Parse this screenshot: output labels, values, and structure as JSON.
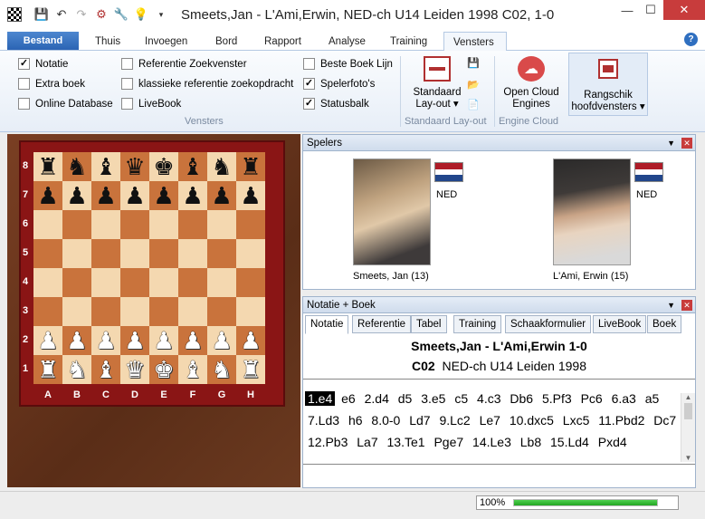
{
  "window": {
    "title": "Smeets,Jan - L'Ami,Erwin, NED-ch U14 Leiden 1998  C02, 1-0",
    "min": "—",
    "max": "☐",
    "close": "✕"
  },
  "tabs": [
    "Bestand",
    "Thuis",
    "Invoegen",
    "Bord",
    "Rapport",
    "Analyse",
    "Training",
    "Vensters"
  ],
  "ribbon": {
    "checks": [
      {
        "label": "Notatie",
        "checked": true
      },
      {
        "label": "Extra boek",
        "checked": false
      },
      {
        "label": "Online Database",
        "checked": false
      },
      {
        "label": "Referentie Zoekvenster",
        "checked": false
      },
      {
        "label": "klassieke referentie zoekopdracht",
        "checked": false
      },
      {
        "label": "LiveBook",
        "checked": false
      },
      {
        "label": "Beste Boek Lijn",
        "checked": false
      },
      {
        "label": "Spelerfoto's",
        "checked": true
      },
      {
        "label": "Statusbalk",
        "checked": true
      }
    ],
    "group_vensters": "Vensters",
    "layout_btn_1": "Standaard",
    "layout_btn_2": "Lay-out ▾",
    "group_layout": "Standaard Lay-out",
    "cloud_btn_1": "Open Cloud",
    "cloud_btn_2": "Engines",
    "group_cloud": "Engine Cloud",
    "arrange_btn_1": "Rangschik",
    "arrange_btn_2": "hoofdvensters ▾"
  },
  "board": {
    "ranks": [
      "8",
      "7",
      "6",
      "5",
      "4",
      "3",
      "2",
      "1"
    ],
    "files": [
      "A",
      "B",
      "C",
      "D",
      "E",
      "F",
      "G",
      "H"
    ],
    "position": [
      [
        "br",
        "bn",
        "bb",
        "bq",
        "bk",
        "bb",
        "bn",
        "br"
      ],
      [
        "bp",
        "bp",
        "bp",
        "bp",
        "bp",
        "bp",
        "bp",
        "bp"
      ],
      [
        "",
        "",
        "",
        "",
        "",
        "",
        "",
        ""
      ],
      [
        "",
        "",
        "",
        "",
        "",
        "",
        "",
        ""
      ],
      [
        "",
        "",
        "",
        "",
        "",
        "",
        "",
        ""
      ],
      [
        "",
        "",
        "",
        "",
        "",
        "",
        "",
        ""
      ],
      [
        "wp",
        "wp",
        "wp",
        "wp",
        "wp",
        "wp",
        "wp",
        "wp"
      ],
      [
        "wr",
        "wn",
        "wb",
        "wq",
        "wk",
        "wb",
        "wn",
        "wr"
      ]
    ]
  },
  "players": {
    "title": "Spelers",
    "white": {
      "name": "Smeets, Jan  (13)",
      "country": "NED"
    },
    "black": {
      "name": "L'Ami, Erwin  (15)",
      "country": "NED"
    }
  },
  "notation": {
    "title": "Notatie + Boek",
    "tabs": [
      "Notatie",
      "Referentie",
      "Tabel",
      "Training",
      "Schaakformulier",
      "LiveBook",
      "Boek"
    ],
    "header": "Smeets,Jan - L'Ami,Erwin  1-0",
    "eco": "C02",
    "event": "NED-ch U14 Leiden 1998",
    "moves": [
      "1.e4",
      "e6",
      "2.d4",
      "d5",
      "3.e5",
      "c5",
      "4.c3",
      "Db6",
      "5.Pf3",
      "Pc6",
      "6.a3",
      "a5",
      "7.Ld3",
      "h6",
      "8.0-0",
      "Ld7",
      "9.Lc2",
      "Le7",
      "10.dxc5",
      "Lxc5",
      "11.Pbd2",
      "Dc7",
      "12.Pb3",
      "La7",
      "13.Te1",
      "Pge7",
      "14.Le3",
      "Lb8",
      "15.Ld4",
      "Pxd4"
    ]
  },
  "status": {
    "zoom": "100%",
    "progress": 1.0
  }
}
